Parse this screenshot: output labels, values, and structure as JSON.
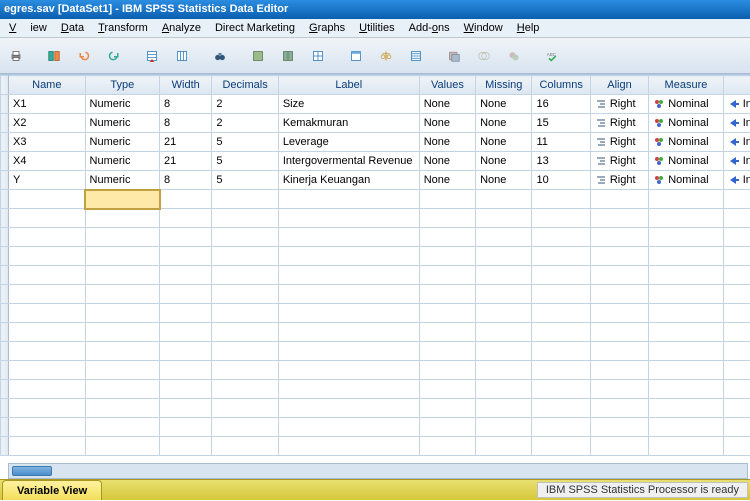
{
  "title": "egres.sav [DataSet1] - IBM SPSS Statistics Data Editor",
  "menu": {
    "view": "View",
    "data": "Data",
    "transform": "Transform",
    "analyze": "Analyze",
    "dm": "Direct Marketing",
    "graphs": "Graphs",
    "utilities": "Utilities",
    "addons": "Add-ons",
    "window": "Window",
    "help": "Help"
  },
  "hdr": {
    "name": "Name",
    "type": "Type",
    "width": "Width",
    "decimals": "Decimals",
    "label": "Label",
    "values": "Values",
    "missing": "Missing",
    "columns": "Columns",
    "align": "Align",
    "measure": "Measure"
  },
  "rows": [
    {
      "name": "X1",
      "type": "Numeric",
      "width": "8",
      "dec": "2",
      "label": "Size",
      "values": "None",
      "missing": "None",
      "columns": "16",
      "align": "Right",
      "measure": "Nominal",
      "role": "In"
    },
    {
      "name": "X2",
      "type": "Numeric",
      "width": "8",
      "dec": "2",
      "label": "Kemakmuran",
      "values": "None",
      "missing": "None",
      "columns": "15",
      "align": "Right",
      "measure": "Nominal",
      "role": "In"
    },
    {
      "name": "X3",
      "type": "Numeric",
      "width": "21",
      "dec": "5",
      "label": "Leverage",
      "values": "None",
      "missing": "None",
      "columns": "11",
      "align": "Right",
      "measure": "Nominal",
      "role": "In"
    },
    {
      "name": "X4",
      "type": "Numeric",
      "width": "21",
      "dec": "5",
      "label": "Intergovermental Revenue",
      "values": "None",
      "missing": "None",
      "columns": "13",
      "align": "Right",
      "measure": "Nominal",
      "role": "In"
    },
    {
      "name": "Y",
      "type": "Numeric",
      "width": "8",
      "dec": "5",
      "label": "Kinerja Keuangan",
      "values": "None",
      "missing": "None",
      "columns": "10",
      "align": "Right",
      "measure": "Nominal",
      "role": "In"
    }
  ],
  "tabs": {
    "variable": "Variable View"
  },
  "status": "IBM SPSS Statistics Processor is ready"
}
